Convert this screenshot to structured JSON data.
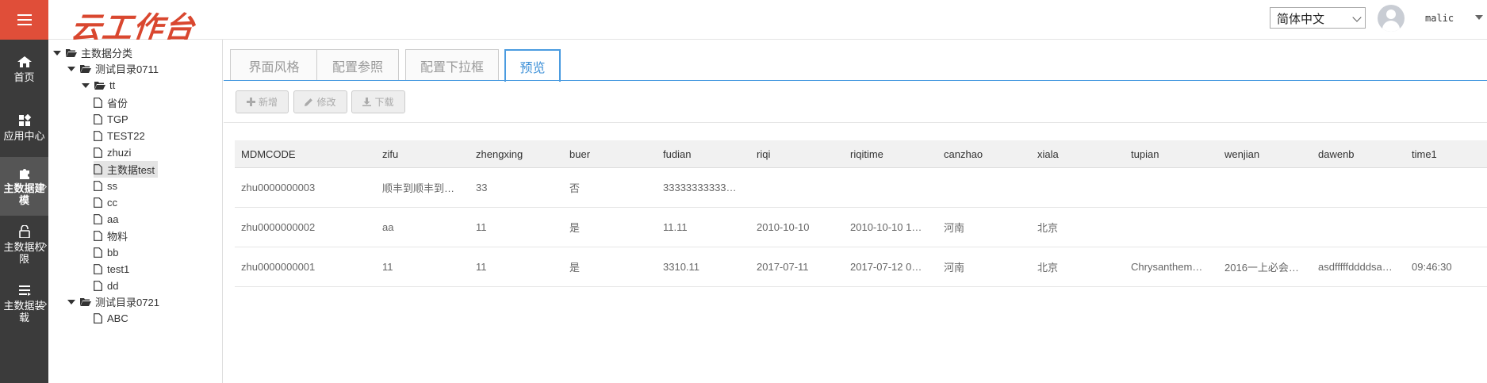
{
  "header": {
    "logo_text": "云工作台",
    "language": "简体中文",
    "username": "malic"
  },
  "leftnav": [
    {
      "label": "首页",
      "icon": "home-icon"
    },
    {
      "label": "应用中心",
      "icon": "apps-icon"
    },
    {
      "label": "主数据建\n模",
      "icon": "puzzle-icon"
    },
    {
      "label": "主数据权\n限",
      "icon": "lock-icon"
    },
    {
      "label": "主数据装\n载",
      "icon": "list-icon"
    }
  ],
  "tree": {
    "root": "主数据分类",
    "dir1": "测试目录0711",
    "dir_tt": "tt",
    "files": [
      "省份",
      "TGP",
      "TEST22",
      "zhuzi",
      "主数据test",
      "ss",
      "cc",
      "aa",
      "物料",
      "bb",
      "test1",
      "dd"
    ],
    "dir2": "测试目录0721",
    "file_abc": "ABC"
  },
  "tabs": [
    "界面风格",
    "配置参照",
    "配置下拉框",
    "预览"
  ],
  "toolbar": {
    "add_label": "新增",
    "edit_label": "修改",
    "download_label": "下载"
  },
  "grid": {
    "columns": [
      "MDMCODE",
      "zifu",
      "zhengxing",
      "buer",
      "fudian",
      "riqi",
      "riqitime",
      "canzhao",
      "xiala",
      "tupian",
      "wenjian",
      "dawenb",
      "time1"
    ],
    "rows": [
      [
        "zhu0000000003",
        "顺丰到顺丰到…",
        "33",
        "否",
        "33333333333…",
        "",
        "",
        "",
        "",
        "",
        "",
        "",
        ""
      ],
      [
        "zhu0000000002",
        "aa",
        "11",
        "是",
        "11.11",
        "2010-10-10",
        "2010-10-10 1…",
        "河南",
        "北京",
        "",
        "",
        "",
        ""
      ],
      [
        "zhu0000000001",
        "11",
        "11",
        "是",
        "3310.11",
        "2017-07-11",
        "2017-07-12 0…",
        "河南",
        "北京",
        "Chrysanthem…",
        "2016一上必会…",
        "asdfffffddddsa…",
        "09:46:30"
      ]
    ]
  },
  "colors": {
    "brand_red": "#e04e39",
    "nav_dark": "#3b3b3b",
    "tab_blue": "#4a9be0"
  }
}
